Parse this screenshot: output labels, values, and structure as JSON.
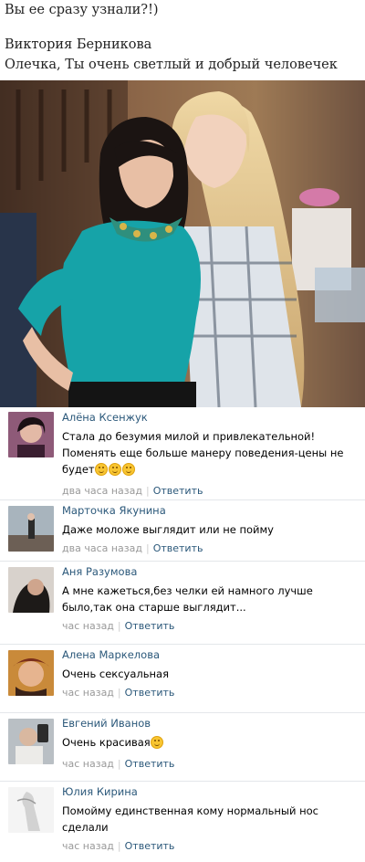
{
  "post": {
    "line1": "Вы ее сразу узнали?!)",
    "line2": "Виктория Берникова",
    "line3": "Олечка, Ты очень светлый и добрый человечек"
  },
  "comments": [
    {
      "author": "Алёна Ксенжук",
      "text": "Стала до безумия милой и привлекательной! Поменять еще больше манеру поведения-цены не будет",
      "emoji_count": 3,
      "time": "два часа назад",
      "reply": "Ответить"
    },
    {
      "author": "Марточка Якунина",
      "text": "Даже моложе выглядит или не пойму",
      "emoji_count": 0,
      "time": "два часа назад",
      "reply": "Ответить"
    },
    {
      "author": "Аня Разумова",
      "text": "А мне кажеться,без челки ей намного лучше было,так она старше выглядит...",
      "emoji_count": 0,
      "time": "час назад",
      "reply": "Ответить"
    },
    {
      "author": "Алена Маркелова",
      "text": "Очень сексуальная",
      "emoji_count": 0,
      "time": "час назад",
      "reply": "Ответить"
    },
    {
      "author": "Евгений Иванов",
      "text": "Очень красивая",
      "emoji_count": 1,
      "time": "час назад",
      "reply": "Ответить"
    },
    {
      "author": "Юлия Кирина",
      "text": "Помойму единственная кому нормальный нос сделали",
      "emoji_count": 0,
      "time": "час назад",
      "reply": "Ответить"
    }
  ],
  "colors": {
    "author_link": "#2b587a",
    "meta_text": "#999999",
    "divider": "#e4e7ea"
  }
}
